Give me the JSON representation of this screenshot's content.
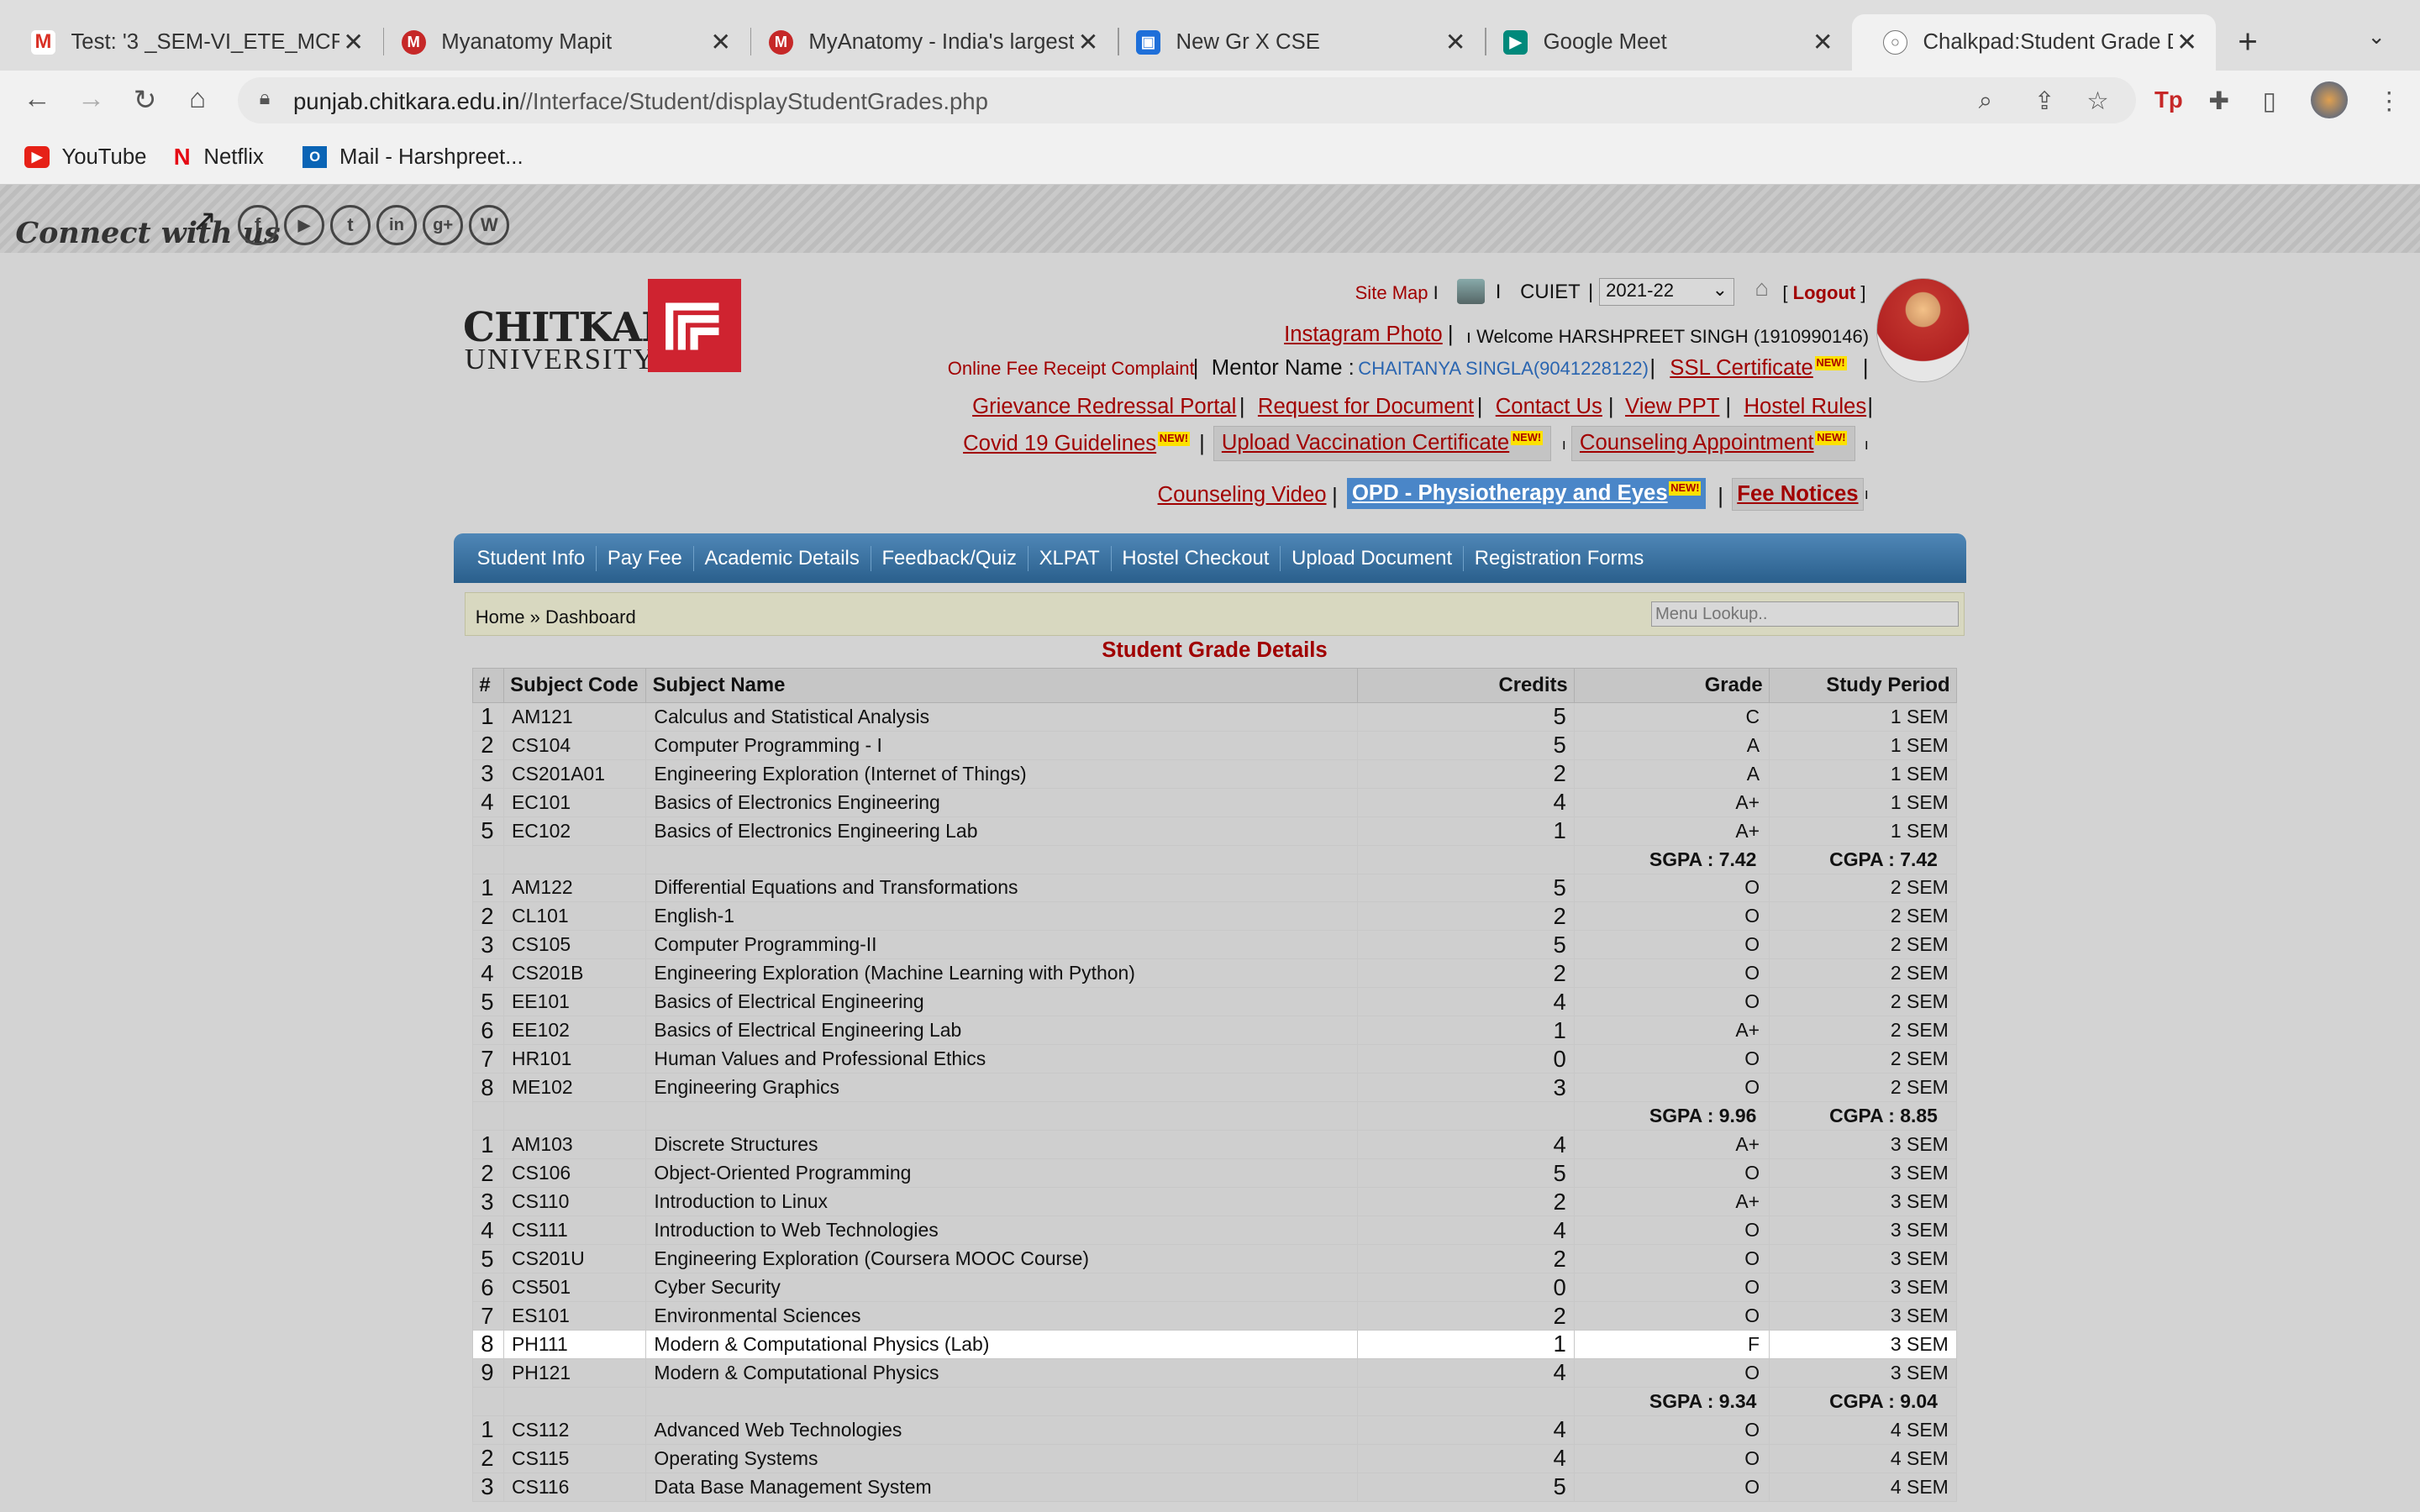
{
  "browser": {
    "tabs": [
      {
        "title": "Test: '3 _SEM-VI_ETE_MCF",
        "icon": "gmail-icon",
        "color": "#d93025"
      },
      {
        "title": "Myanatomy Mapit",
        "icon": "myanatomy-icon",
        "color": "#c62828"
      },
      {
        "title": "MyAnatomy - India's largest",
        "icon": "myanatomy-icon",
        "color": "#c62828"
      },
      {
        "title": "New Gr X CSE",
        "icon": "classroom-icon",
        "color": "#1e6fd9"
      },
      {
        "title": "Google Meet",
        "icon": "meet-icon",
        "color": "#00897b"
      },
      {
        "title": "Chalkpad:Student Grade De",
        "icon": "globe-icon",
        "color": "#666666"
      }
    ],
    "url_host": "punjab.chitkara.edu.in",
    "url_path": "//Interface/Student/displayStudentGrades.php",
    "bookmarks": [
      "YouTube",
      "Netflix",
      "Mail - Harshpreet..."
    ]
  },
  "header": {
    "connect_text": "Connect with us",
    "social_icons": [
      "f",
      "▶",
      "t",
      "in",
      "g+",
      "W"
    ],
    "logo_top": "CHITKARA",
    "logo_bottom": "UNIVERSITY",
    "site_map": "Site Map",
    "institute": "CUIET",
    "session": "2021-22",
    "logout": "Logout",
    "instagram": "Instagram Photo",
    "welcome": "Welcome HARSHPREET SINGH (1910990146)",
    "fee_complaint": "Online Fee Receipt Complaint",
    "mentor_label": "Mentor Name :",
    "mentor_name": "CHAITANYA SINGLA(9041228122)",
    "ssl": "SSL Certificate",
    "grievance": "Grievance Redressal Portal",
    "request_doc": "Request for Document",
    "contact": "Contact Us",
    "view_ppt": "View PPT",
    "hostel_rules": "Hostel Rules",
    "covid": "Covid 19 Guidelines",
    "upload_vacc": "Upload Vaccination Certificate",
    "counseling_appt": "Counseling Appointment",
    "counseling_video": "Counseling Video",
    "opd": "OPD - Physiotherapy and Eyes",
    "fee_notices": "Fee Notices",
    "new_badge": "NEW!"
  },
  "menu": [
    "Student Info",
    "Pay Fee",
    "Academic Details",
    "Feedback/Quiz",
    "XLPAT",
    "Hostel Checkout",
    "Upload Document",
    "Registration Forms"
  ],
  "breadcrumb": "Home » Dashboard",
  "menu_lookup_placeholder": "Menu Lookup..",
  "grades": {
    "title": "Student Grade Details",
    "headers": [
      "#",
      "Subject Code",
      "Subject Name",
      "Credits",
      "Grade",
      "Study Period"
    ],
    "rows": [
      {
        "n": "1",
        "code": "AM121",
        "name": "Calculus and Statistical Analysis",
        "credits": "5",
        "grade": "C",
        "period": "1 SEM"
      },
      {
        "n": "2",
        "code": "CS104",
        "name": "Computer Programming - I",
        "credits": "5",
        "grade": "A",
        "period": "1 SEM"
      },
      {
        "n": "3",
        "code": "CS201A01",
        "name": "Engineering Exploration (Internet of Things)",
        "credits": "2",
        "grade": "A",
        "period": "1 SEM"
      },
      {
        "n": "4",
        "code": "EC101",
        "name": "Basics of Electronics Engineering",
        "credits": "4",
        "grade": "A+",
        "period": "1 SEM"
      },
      {
        "n": "5",
        "code": "EC102",
        "name": "Basics of Electronics Engineering Lab",
        "credits": "1",
        "grade": "A+",
        "period": "1 SEM"
      },
      {
        "sgpa": "SGPA :  7.42",
        "cgpa": "CGPA :  7.42"
      },
      {
        "n": "1",
        "code": "AM122",
        "name": "Differential Equations and Transformations",
        "credits": "5",
        "grade": "O",
        "period": "2 SEM"
      },
      {
        "n": "2",
        "code": "CL101",
        "name": "English-1",
        "credits": "2",
        "grade": "O",
        "period": "2 SEM"
      },
      {
        "n": "3",
        "code": "CS105",
        "name": "Computer Programming-II",
        "credits": "5",
        "grade": "O",
        "period": "2 SEM"
      },
      {
        "n": "4",
        "code": "CS201B",
        "name": "Engineering Exploration (Machine Learning with Python)",
        "credits": "2",
        "grade": "O",
        "period": "2 SEM"
      },
      {
        "n": "5",
        "code": "EE101",
        "name": "Basics of Electrical Engineering",
        "credits": "4",
        "grade": "O",
        "period": "2 SEM"
      },
      {
        "n": "6",
        "code": "EE102",
        "name": "Basics of Electrical Engineering Lab",
        "credits": "1",
        "grade": "A+",
        "period": "2 SEM"
      },
      {
        "n": "7",
        "code": "HR101",
        "name": "Human Values and Professional Ethics",
        "credits": "0",
        "grade": "O",
        "period": "2 SEM"
      },
      {
        "n": "8",
        "code": "ME102",
        "name": "Engineering Graphics",
        "credits": "3",
        "grade": "O",
        "period": "2 SEM"
      },
      {
        "sgpa": "SGPA :  9.96",
        "cgpa": "CGPA :  8.85"
      },
      {
        "n": "1",
        "code": "AM103",
        "name": "Discrete Structures",
        "credits": "4",
        "grade": "A+",
        "period": "3 SEM"
      },
      {
        "n": "2",
        "code": "CS106",
        "name": "Object-Oriented Programming",
        "credits": "5",
        "grade": "O",
        "period": "3 SEM"
      },
      {
        "n": "3",
        "code": "CS110",
        "name": "Introduction to Linux",
        "credits": "2",
        "grade": "A+",
        "period": "3 SEM"
      },
      {
        "n": "4",
        "code": "CS111",
        "name": "Introduction to Web Technologies",
        "credits": "4",
        "grade": "O",
        "period": "3 SEM"
      },
      {
        "n": "5",
        "code": "CS201U",
        "name": "Engineering Exploration (Coursera MOOC Course)",
        "credits": "2",
        "grade": "O",
        "period": "3 SEM"
      },
      {
        "n": "6",
        "code": "CS501",
        "name": "Cyber Security",
        "credits": "0",
        "grade": "O",
        "period": "3 SEM"
      },
      {
        "n": "7",
        "code": "ES101",
        "name": "Environmental Sciences",
        "credits": "2",
        "grade": "O",
        "period": "3 SEM"
      },
      {
        "n": "8",
        "code": "PH111",
        "name": "Modern & Computational Physics (Lab)",
        "credits": "1",
        "grade": "F",
        "period": "3 SEM",
        "highlight": true
      },
      {
        "n": "9",
        "code": "PH121",
        "name": "Modern & Computational Physics",
        "credits": "4",
        "grade": "O",
        "period": "3 SEM"
      },
      {
        "sgpa": "SGPA :  9.34",
        "cgpa": "CGPA :  9.04"
      },
      {
        "n": "1",
        "code": "CS112",
        "name": "Advanced Web Technologies",
        "credits": "4",
        "grade": "O",
        "period": "4 SEM"
      },
      {
        "n": "2",
        "code": "CS115",
        "name": "Operating Systems",
        "credits": "4",
        "grade": "O",
        "period": "4 SEM"
      },
      {
        "n": "3",
        "code": "CS116",
        "name": "Data Base Management System",
        "credits": "5",
        "grade": "O",
        "period": "4 SEM"
      }
    ]
  }
}
